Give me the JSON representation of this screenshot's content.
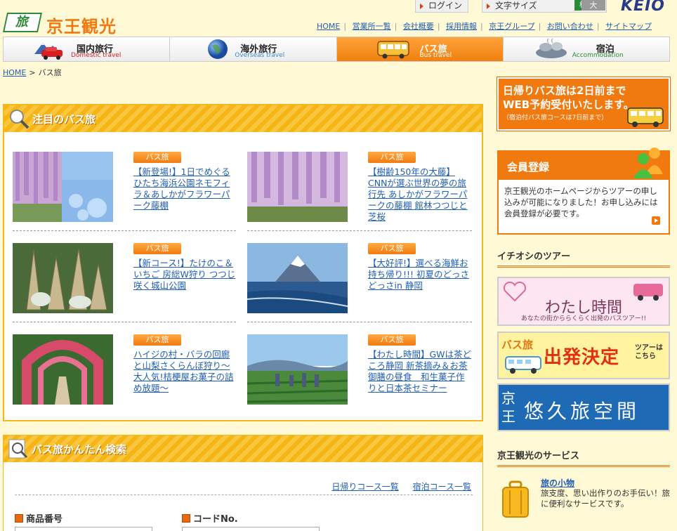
{
  "header": {
    "logo_mark": "旅",
    "logo_text": "京王観光",
    "brand_logo": "KEIO",
    "login": "ログイン",
    "font_size_label": "文字サイズ",
    "font_size_standard": "標準",
    "font_size_large": "大",
    "util_links": [
      "HOME",
      "営業所一覧",
      "会社概要",
      "採用情報",
      "京王グループ",
      "お問い合わせ",
      "サイトマップ"
    ]
  },
  "nav": {
    "tabs": [
      {
        "title": "国内旅行",
        "sub": "Domestic travel",
        "icon": "car-icon"
      },
      {
        "title": "海外旅行",
        "sub": "Overseas travel",
        "icon": "globe-icon"
      },
      {
        "title": "バス旅",
        "sub": "Bus travel",
        "icon": "bus-icon",
        "active": true
      },
      {
        "title": "宿泊",
        "sub": "Accommodation",
        "icon": "onsen-icon"
      }
    ]
  },
  "breadcrumb": {
    "home": "HOME",
    "sep": ">",
    "current": "バス旅"
  },
  "featured": {
    "title": "注目のバス旅",
    "cards": [
      {
        "badge": "バス旅",
        "title": "【新登場!】1日でめぐる ひたち海浜公園ネモフィラ＆あしかがフラワーパーク藤棚"
      },
      {
        "badge": "バス旅",
        "title": "【樹齢150年の大藤】CNNが選ぶ世界の夢の旅行先 あしかがフラワーパークの藤棚 館林つつじと芝桜"
      },
      {
        "badge": "バス旅",
        "title": "【新コース!】たけのこ＆いちご 房総W狩り つつじ咲く城山公園"
      },
      {
        "badge": "バス旅",
        "title": "【大好評!】選べる海鮮お持ち帰り!!! 初夏のどっさどっさin 静岡"
      },
      {
        "badge": "バス旅",
        "title": "ハイジの村・バラの回廊と山梨さくらんぼ狩り～大人気!桔梗屋お菓子の詰め放題～"
      },
      {
        "badge": "バス旅",
        "title": "【わたし時間】GWは茶どころ静岡 新茶摘み＆お茶御膳の昼食　和生菓子作りと日本茶セミナー"
      }
    ]
  },
  "search": {
    "title": "バス旅かんたん検索",
    "link_day": "日帰りコース一覧",
    "link_stay": "宿泊コース一覧",
    "label_product": "商品番号",
    "label_code": "コードNo."
  },
  "sidebar": {
    "web_banner": {
      "line1": "日帰りバス旅は2日前まで",
      "line2": "WEB予約受付いたします。",
      "line3": "（宿泊付バス旅コースは7日前まで）"
    },
    "member": {
      "title": "会員登録",
      "text": "京王観光のホームページからツアーの申し込みが可能になりました！お申し込みには会員登録が必要です。"
    },
    "recommend_heading": "イチオシのツアー",
    "banner_watashi": "わたし時間",
    "banner_watashi_sub": "あなたの街かららくらく出発のバスツアー!!",
    "banner_decided_a": "バス旅",
    "banner_decided_b": "出発決定",
    "banner_decided_c": "ツアーはこちら",
    "banner_keio_a": "京王",
    "banner_keio_b": "悠久旅空間",
    "service_heading": "京王観光のサービス",
    "service_item_title": "旅の小物",
    "service_item_desc": "旅支度、思い出作りのお手伝い！旅に便利なサービスです。"
  }
}
